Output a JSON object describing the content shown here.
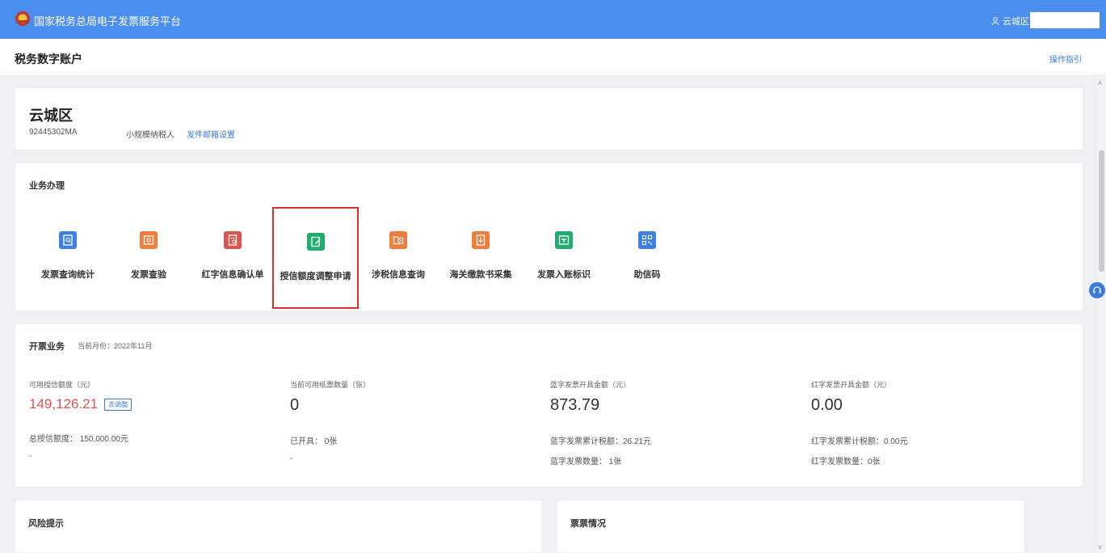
{
  "header": {
    "app_title": "国家税务总局电子发票服务平台",
    "user_name": "云城区"
  },
  "subheader": {
    "page_title": "税务数字账户",
    "guide_link": "操作指引"
  },
  "taxpayer": {
    "name": "云城区",
    "tax_id": "92445302MA",
    "type": "小规模纳税人",
    "email_setting": "发件邮箱设置"
  },
  "business": {
    "title": "业务办理",
    "items": [
      {
        "label": "发票查询统计",
        "icon": "search-doc-icon",
        "color": "#3e7fe0"
      },
      {
        "label": "发票查验",
        "icon": "verify-icon",
        "color": "#ef7d3c"
      },
      {
        "label": "红字信息确认单",
        "icon": "red-doc-icon",
        "color": "#e0524d"
      },
      {
        "label": "授信额度调整申请",
        "icon": "edit-doc-icon",
        "color": "#1fae6d"
      },
      {
        "label": "涉税信息查询",
        "icon": "folder-search-icon",
        "color": "#ef7d3c"
      },
      {
        "label": "海关缴款书采集",
        "icon": "download-doc-icon",
        "color": "#ef7d3c"
      },
      {
        "label": "发票入账标识",
        "icon": "inbox-icon",
        "color": "#1fae6d"
      },
      {
        "label": "助信码",
        "icon": "qr-code-icon",
        "color": "#3e7fe0"
      }
    ]
  },
  "invoicing": {
    "title": "开票业务",
    "current_month": "当前月份：2022年11月",
    "kpis": [
      {
        "label": "可用授信额度（元）",
        "value": "149,126.21",
        "badge": "去调整",
        "sub1": "总授信额度： 150,000.00元",
        "sub2": "-"
      },
      {
        "label": "当前可用纸票数量（张）",
        "value": "0",
        "sub1": "已开具： 0张",
        "sub2": "-"
      },
      {
        "label": "蓝字发票开具金额（元）",
        "value": "873.79",
        "sub1": "蓝字发票累计税额：26.21元",
        "sub2": "蓝字发票数量： 1张"
      },
      {
        "label": "红字发票开具金额（元）",
        "value": "0.00",
        "sub1": "红字发票累计税额：0.00元",
        "sub2": "红字发票数量：0张"
      }
    ]
  },
  "risk": {
    "title": "风险提示"
  },
  "ticket": {
    "title": "票票情况"
  }
}
